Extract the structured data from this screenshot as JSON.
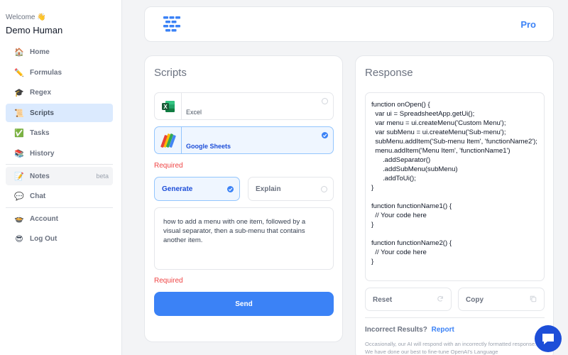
{
  "sidebar": {
    "welcome": "Welcome 👋",
    "user_name": "Demo Human",
    "items": [
      {
        "label": "Home",
        "icon": "home-icon",
        "emoji": "🏠"
      },
      {
        "label": "Formulas",
        "icon": "pencil-icon",
        "emoji": "✏️"
      },
      {
        "label": "Regex",
        "icon": "graduation-cap-icon",
        "emoji": "🎓"
      },
      {
        "label": "Scripts",
        "icon": "scroll-icon",
        "emoji": "📜"
      },
      {
        "label": "Tasks",
        "icon": "checkmark-icon",
        "emoji": "✅"
      },
      {
        "label": "History",
        "icon": "books-icon",
        "emoji": "📚"
      },
      {
        "label": "Notes",
        "icon": "memo-icon",
        "emoji": "📝",
        "badge": "beta"
      },
      {
        "label": "Chat",
        "icon": "speech-bubble-icon",
        "emoji": "💬"
      },
      {
        "label": "Account",
        "icon": "pot-icon",
        "emoji": "🍲"
      },
      {
        "label": "Log Out",
        "icon": "sunglasses-icon",
        "emoji": "😎"
      }
    ]
  },
  "header": {
    "plan_label": "Pro"
  },
  "scripts": {
    "title": "Scripts",
    "apps": [
      {
        "label": "Excel",
        "icon": "excel-icon"
      },
      {
        "label": "Google Sheets",
        "icon": "google-sheets-icon"
      }
    ],
    "required_label": "Required",
    "modes": [
      {
        "label": "Generate"
      },
      {
        "label": "Explain"
      }
    ],
    "prompt": "how to add a menu with one item, followed by a visual separator, then a sub-menu that contains another item.",
    "required_label_2": "Required",
    "send_label": "Send"
  },
  "response": {
    "title": "Response",
    "code": "function onOpen() {\n  var ui = SpreadsheetApp.getUi();\n  var menu = ui.createMenu('Custom Menu');\n  var subMenu = ui.createMenu('Sub-menu');\n  subMenu.addItem('Sub-menu Item', 'functionName2');\n  menu.addItem('Menu Item', 'functionName1')\n      .addSeparator()\n      .addSubMenu(subMenu)\n      .addToUi();\n}\n\nfunction functionName1() {\n  // Your code here\n}\n\nfunction functionName2() {\n  // Your code here\n}",
    "reset_label": "Reset",
    "copy_label": "Copy",
    "incorrect_label": "Incorrect Results?",
    "report_label": "Report",
    "disclaimer": "Occasionally, our AI will respond with an incorrectly formatted response. We have done our best to fine-tune OpenAI's  Language"
  },
  "colors": {
    "accent": "#3b82f6",
    "active_bg": "#dbeafe",
    "required": "#ef4444",
    "chat_bubble": "#1d4ed8"
  }
}
